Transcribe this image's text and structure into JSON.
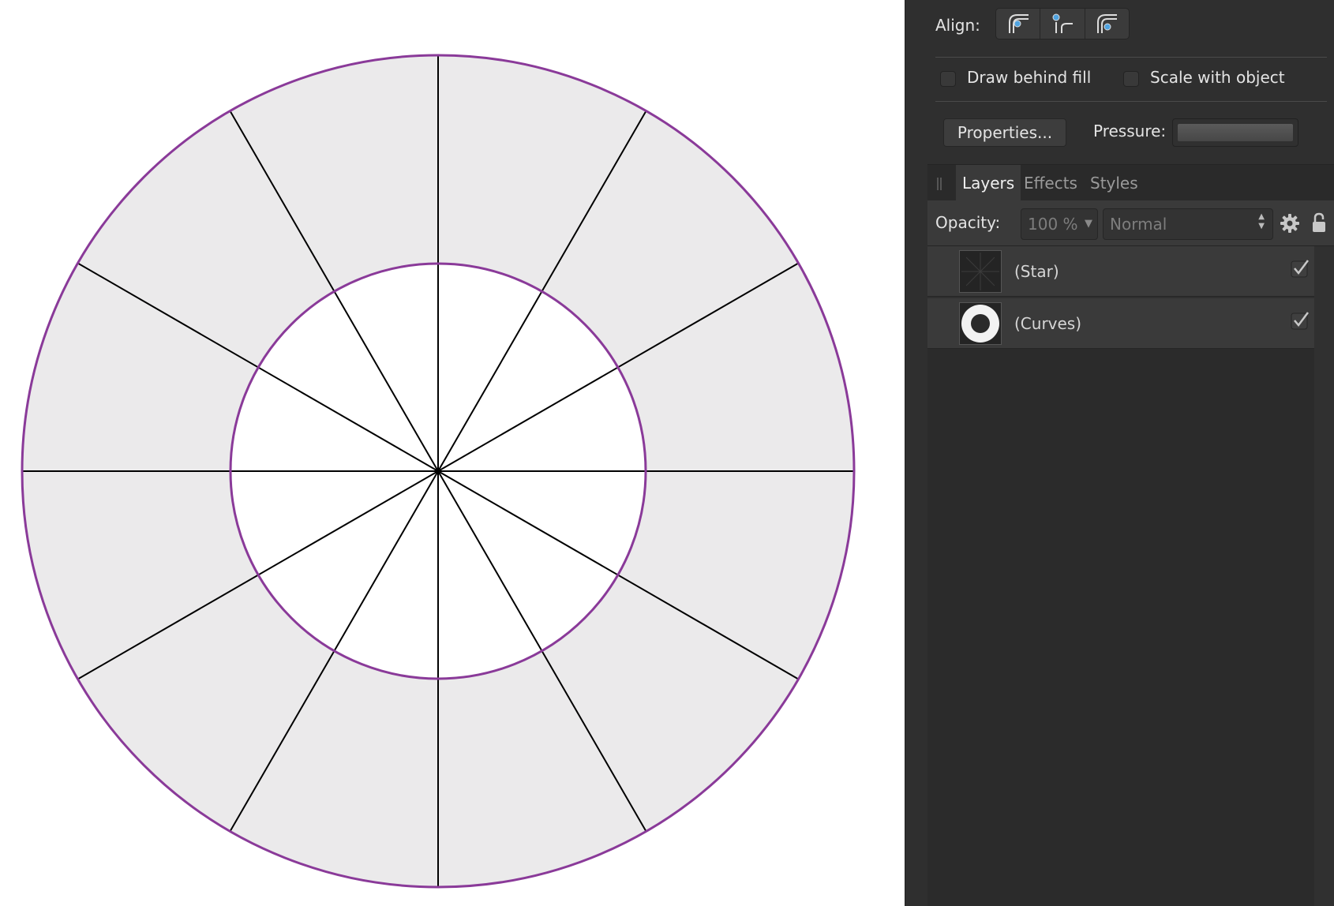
{
  "panel": {
    "align_label": "Align:",
    "draw_behind_fill_label": "Draw behind fill",
    "scale_with_object_label": "Scale with object",
    "properties_button": "Properties...",
    "pressure_label": "Pressure:"
  },
  "tabs": [
    {
      "label": "Layers",
      "active": true
    },
    {
      "label": "Effects",
      "active": false
    },
    {
      "label": "Styles",
      "active": false
    }
  ],
  "opacity": {
    "label": "Opacity:",
    "value": "100 %",
    "blend_mode": "Normal"
  },
  "layers": [
    {
      "name": "(Star)",
      "visible": true
    },
    {
      "name": "(Curves)",
      "visible": true
    }
  ],
  "colors": {
    "stroke_ring": "#8a3a99",
    "ring_fill": "#ebeaeb",
    "spoke": "#000000",
    "panel_bg": "#2f2f2f"
  },
  "icons": {
    "align_buttons": [
      "align-inside-icon",
      "align-center-icon",
      "align-outside-icon"
    ],
    "settings": "gear-icon",
    "lock": "lock-icon",
    "check": "checkmark-icon"
  }
}
